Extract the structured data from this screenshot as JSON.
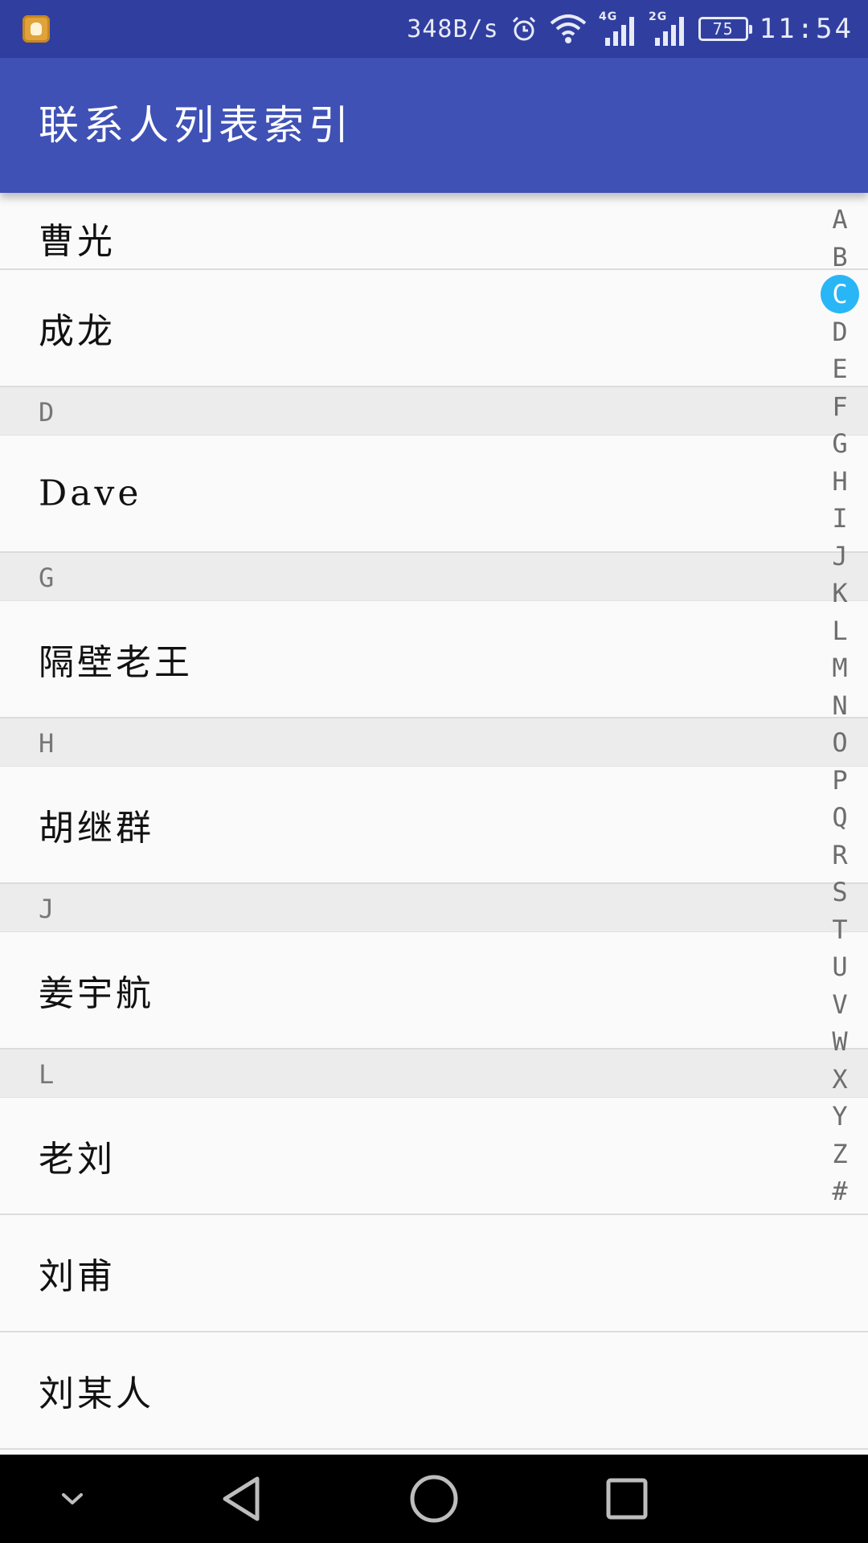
{
  "status_bar": {
    "net_speed": "348B/s",
    "network_labels": [
      "4G",
      "2G"
    ],
    "battery": "75",
    "time": "11:54"
  },
  "app_bar": {
    "title": "联系人列表索引"
  },
  "list": {
    "rows": [
      {
        "type": "item",
        "name": "曹光"
      },
      {
        "type": "item",
        "name": "成龙"
      },
      {
        "type": "header",
        "letter": "D"
      },
      {
        "type": "item",
        "name": "Dave"
      },
      {
        "type": "header",
        "letter": "G"
      },
      {
        "type": "item",
        "name": "隔壁老王"
      },
      {
        "type": "header",
        "letter": "H"
      },
      {
        "type": "item",
        "name": "胡继群"
      },
      {
        "type": "header",
        "letter": "J"
      },
      {
        "type": "item",
        "name": "姜宇航"
      },
      {
        "type": "header",
        "letter": "L"
      },
      {
        "type": "item",
        "name": "老刘"
      },
      {
        "type": "item",
        "name": "刘甫"
      },
      {
        "type": "item",
        "name": "刘某人"
      }
    ]
  },
  "index_bar": {
    "letters": [
      "A",
      "B",
      "C",
      "D",
      "E",
      "F",
      "G",
      "H",
      "I",
      "J",
      "K",
      "L",
      "M",
      "N",
      "O",
      "P",
      "Q",
      "R",
      "S",
      "T",
      "U",
      "V",
      "W",
      "X",
      "Y",
      "Z",
      "#"
    ],
    "active": "C",
    "active_color": "#29b6f6"
  },
  "colors": {
    "status_bar": "#303f9f",
    "app_bar": "#3f51b5",
    "section_header": "#ececec"
  }
}
